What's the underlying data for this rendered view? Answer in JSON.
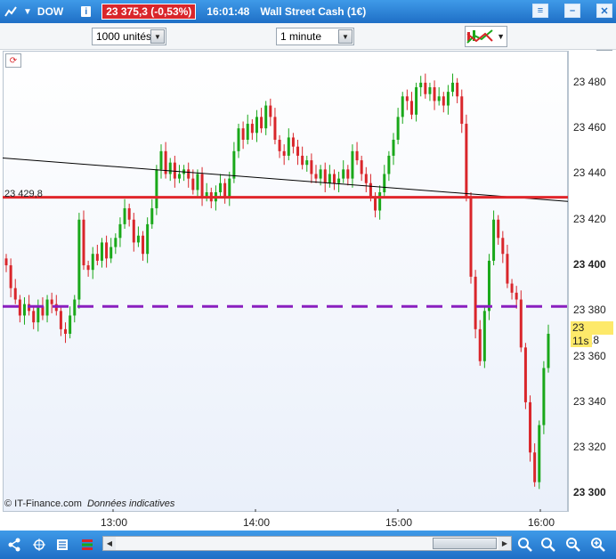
{
  "titlebar": {
    "symbol": "DOW",
    "info_icon": "i",
    "price_badge": "23 375,3 (-0,53%)",
    "time": "16:01:48",
    "instrument": "Wall Street Cash (1€)",
    "buttons": [
      "menu-icon",
      "minimize-icon",
      "close-icon"
    ]
  },
  "toolbar": {
    "units_select": "1000 unités",
    "interval_select": "1 minute"
  },
  "chart": {
    "reference_label": "23 429,8",
    "last_price": "23 370,8",
    "timer": "11s",
    "copyright": "© IT-Finance.com",
    "disclaimer": "Données indicatives",
    "y_ticks": [
      {
        "label": "23 480",
        "bold": false
      },
      {
        "label": "23 460",
        "bold": false
      },
      {
        "label": "23 440",
        "bold": false
      },
      {
        "label": "23 420",
        "bold": false
      },
      {
        "label": "23 400",
        "bold": true
      },
      {
        "label": "23 380",
        "bold": false
      },
      {
        "label": "23 360",
        "bold": false
      },
      {
        "label": "23 340",
        "bold": false
      },
      {
        "label": "23 320",
        "bold": false
      },
      {
        "label": "23 300",
        "bold": true
      }
    ],
    "x_ticks": [
      "13:00",
      "14:00",
      "15:00",
      "16:00"
    ],
    "colors": {
      "up": "#1aa81a",
      "down": "#d9262b",
      "resistance": "#e0262b",
      "dashed": "#8a1fbf",
      "trend": "#000000"
    }
  },
  "chart_data": {
    "type": "candlestick",
    "x_ticks": [
      "13:00",
      "14:00",
      "15:00",
      "16:00"
    ],
    "ylim": [
      23292,
      23494
    ],
    "horizontal_levels": [
      {
        "value": 23429.8,
        "style": "solid"
      },
      {
        "value": 23382,
        "style": "dashed"
      }
    ],
    "trend_line": {
      "from_time": "12:30",
      "from_value": 23447,
      "to_time": "16:08",
      "to_value": 23428
    },
    "closes": [
      23400,
      23390,
      23385,
      23378,
      23383,
      23380,
      23375,
      23382,
      23378,
      23385,
      23383,
      23380,
      23372,
      23370,
      23378,
      23385,
      23420,
      23400,
      23398,
      23405,
      23402,
      23410,
      23403,
      23408,
      23412,
      23418,
      23425,
      23420,
      23410,
      23413,
      23405,
      23418,
      23425,
      23442,
      23450,
      23440,
      23445,
      23438,
      23440,
      23442,
      23438,
      23433,
      23440,
      23430,
      23432,
      23428,
      23432,
      23436,
      23430,
      23438,
      23450,
      23460,
      23455,
      23462,
      23458,
      23465,
      23460,
      23470,
      23465,
      23455,
      23450,
      23448,
      23456,
      23452,
      23448,
      23444,
      23446,
      23440,
      23438,
      23442,
      23436,
      23440,
      23436,
      23438,
      23442,
      23438,
      23450,
      23446,
      23440,
      23436,
      23430,
      23424,
      23432,
      23440,
      23448,
      23455,
      23465,
      23474,
      23472,
      23466,
      23478,
      23480,
      23475,
      23478,
      23472,
      23474,
      23470,
      23476,
      23480,
      23474,
      23462,
      23430,
      23395,
      23372,
      23358,
      23380,
      23402,
      23420,
      23412,
      23405,
      23392,
      23388,
      23385,
      23364,
      23340,
      23318,
      23305,
      23330,
      23355,
      23370
    ]
  },
  "bottombar": {
    "left_icons": [
      "share-icon",
      "crosshair-icon",
      "list-icon",
      "table-icon"
    ],
    "right_icons": [
      "zoom-fit-icon",
      "zoom-out-icon",
      "zoom-in-icon"
    ]
  }
}
